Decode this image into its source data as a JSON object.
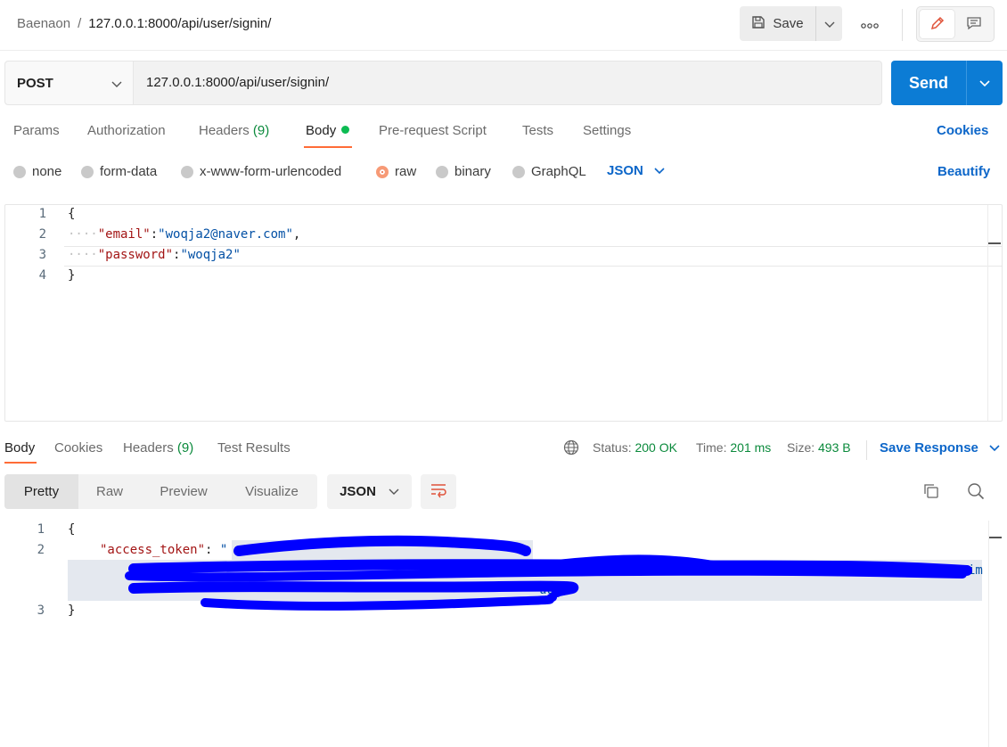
{
  "header": {
    "workspace": "Baenaon",
    "separator": "/",
    "title": "127.0.0.1:8000/api/user/signin/",
    "save_label": "Save"
  },
  "request": {
    "method": "POST",
    "url": "127.0.0.1:8000/api/user/signin/",
    "send_label": "Send"
  },
  "request_tabs": {
    "params": "Params",
    "authorization": "Authorization",
    "headers": "Headers",
    "headers_count": "(9)",
    "body": "Body",
    "prerequest": "Pre-request Script",
    "tests": "Tests",
    "settings": "Settings",
    "cookies": "Cookies"
  },
  "body_types": {
    "none": "none",
    "form_data": "form-data",
    "urlencoded": "x-www-form-urlencoded",
    "raw": "raw",
    "binary": "binary",
    "graphql": "GraphQL",
    "format": "JSON",
    "beautify": "Beautify"
  },
  "request_body": {
    "line_numbers": [
      "1",
      "2",
      "3",
      "4"
    ],
    "open_brace": "{",
    "indent": "····",
    "email_key": "\"email\"",
    "email_value": "\"woqja2@naver.com\"",
    "password_key": "\"password\"",
    "password_value": "\"woqja2\"",
    "colon": ":",
    "comma": ",",
    "close_brace": "}"
  },
  "response_tabs": {
    "body": "Body",
    "cookies": "Cookies",
    "headers": "Headers",
    "headers_count": "(9)",
    "test_results": "Test Results",
    "status_label": "Status:",
    "status_value": "200 OK",
    "time_label": "Time:",
    "time_value": "201 ms",
    "size_label": "Size:",
    "size_value": "493 B",
    "save_response": "Save Response"
  },
  "response_view": {
    "pretty": "Pretty",
    "raw": "Raw",
    "preview": "Preview",
    "visualize": "Visualize",
    "format": "JSON"
  },
  "response_body": {
    "line_numbers": [
      "1",
      "2",
      "3"
    ],
    "open_brace": "{",
    "token_key": "\"access_token\"",
    "colon": ":",
    "token_open_quote": "\"",
    "line2_tail": "im",
    "line3_tail": "uuu\"",
    "close_brace": "}"
  },
  "colors": {
    "accent_orange": "#ff6c37",
    "send_blue": "#0c7cd5",
    "link_blue": "#0c66c9",
    "status_green": "#0b8a3c",
    "redaction_blue": "#0000ff"
  }
}
